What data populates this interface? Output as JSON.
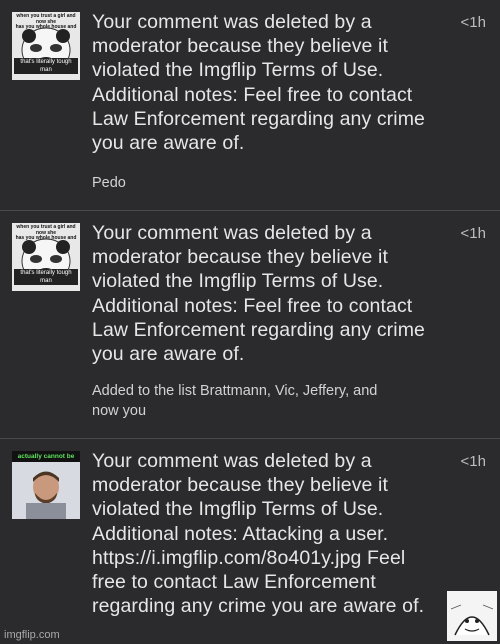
{
  "notifications": [
    {
      "thumb_icon": "panda-meme-face-thumbnail",
      "thumb_top_caption": "when you trust a girl and now she\nhas you whole house and his shop",
      "thumb_bottom_caption": "that's literally tough man",
      "message": "Your comment was deleted by a\nmoderator because they believe it\nviolated the Imgflip Terms of Use.\nAdditional notes: Feel free to contact\nLaw Enforcement regarding any crime\nyou are aware of.",
      "note": "Pedo",
      "time": "<1h"
    },
    {
      "thumb_icon": "panda-meme-face-thumbnail",
      "thumb_top_caption": "when you trust a girl and now she\nhas you whole house and his shop",
      "thumb_bottom_caption": "that's literally tough man",
      "message": "Your comment was deleted by a\nmoderator because they believe it\nviolated the Imgflip Terms of Use.\nAdditional notes: Feel free to contact\nLaw Enforcement regarding any crime\nyou are aware of.",
      "note": "Added to the list Brattmann, Vic, Jeffery, and\nnow you",
      "time": "<1h"
    },
    {
      "thumb_icon": "mugshot-thumbnail",
      "thumb_banner": "actually cannot be funy joke",
      "message": "Your comment was deleted by a\nmoderator because they believe it\nviolated the Imgflip Terms of Use.\nAdditional notes: Attacking a user.\nhttps://i.imgflip.com/8o401y.jpg Feel\nfree to contact Law Enforcement\nregarding any crime you are aware of.",
      "time": "<1h"
    }
  ],
  "footer": {
    "watermark": "imgflip.com",
    "corner_icon": "sketch-meme-face-icon"
  },
  "colors": {
    "background": "#2b2b2d",
    "divider": "#4a4a4c",
    "text": "#e6e6e6",
    "timestamp": "#bdbdbd"
  }
}
